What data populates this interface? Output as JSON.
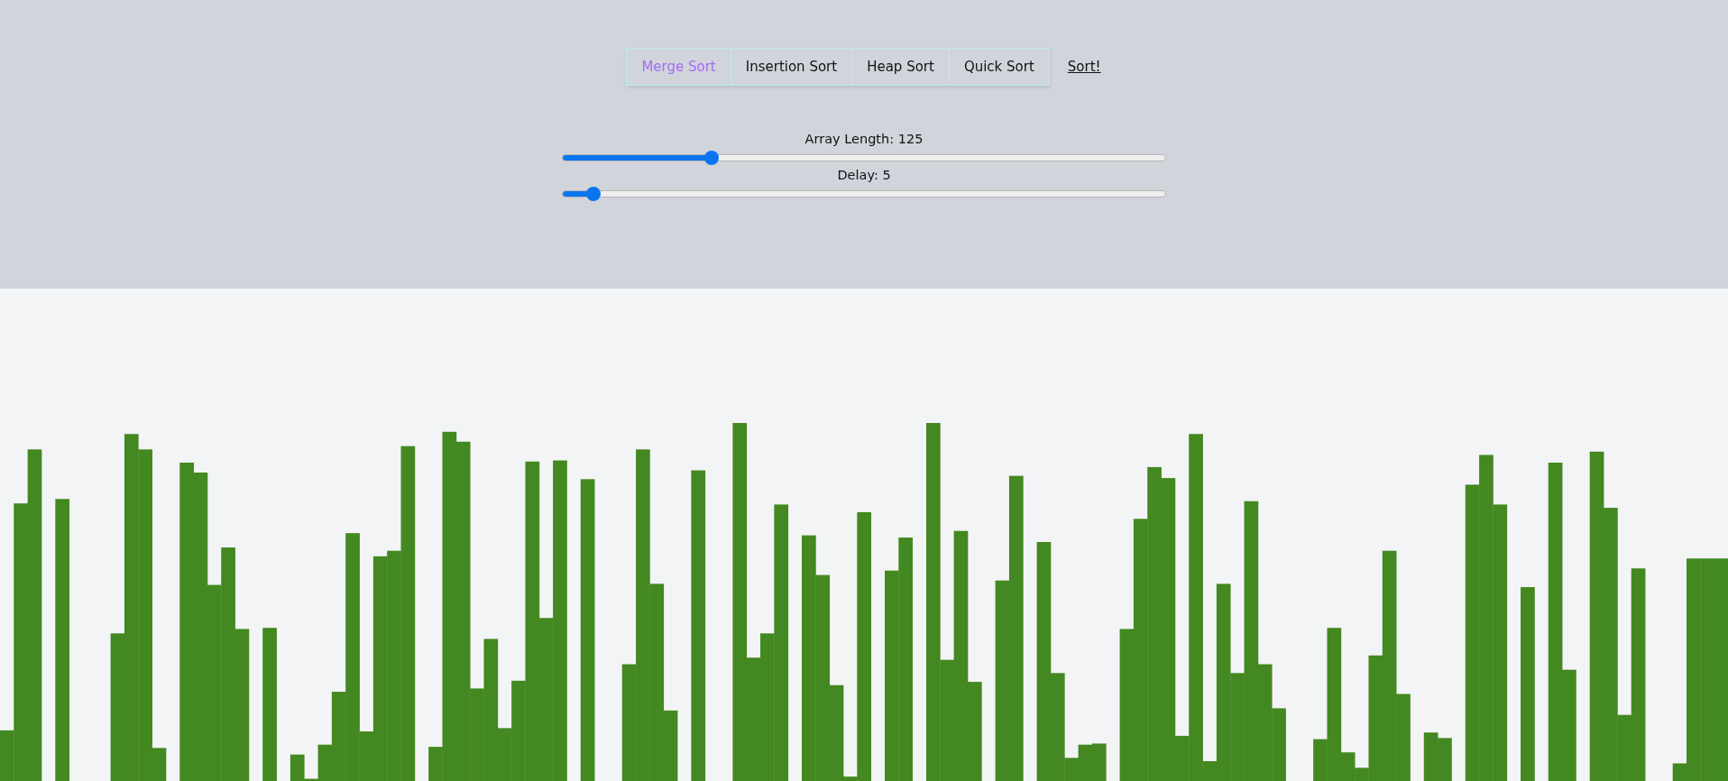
{
  "algorithm_tabs": [
    {
      "label": "Merge Sort",
      "selected": true
    },
    {
      "label": "Insertion Sort",
      "selected": false
    },
    {
      "label": "Heap Sort",
      "selected": false
    },
    {
      "label": "Quick Sort",
      "selected": false
    }
  ],
  "sort_link": "Sort!",
  "sliders": [
    {
      "label": "Array Length: 125",
      "level": 0.247
    },
    {
      "label": "Delay: 5",
      "level": 0.051
    }
  ]
}
